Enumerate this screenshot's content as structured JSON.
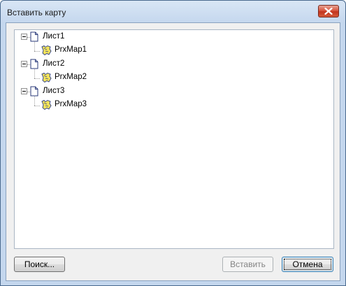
{
  "window": {
    "title": "Вставить карту"
  },
  "tree": {
    "nodes": [
      {
        "label": "Лист1",
        "child": "PrxMap1"
      },
      {
        "label": "Лист2",
        "child": "PrxMap2"
      },
      {
        "label": "Лист3",
        "child": "PrxMap3"
      }
    ]
  },
  "buttons": {
    "search": "Поиск...",
    "insert": "Вставить",
    "cancel": "Отмена"
  },
  "colors": {
    "title_bar": "#c4d7ee",
    "close_button": "#c2341d",
    "dialog_bg": "#f0f0f0",
    "default_button_border": "#3c7fb1"
  },
  "icons": {
    "sheet": "document-icon",
    "map": "map-icon",
    "expander": "collapse-icon",
    "close": "close-icon"
  }
}
